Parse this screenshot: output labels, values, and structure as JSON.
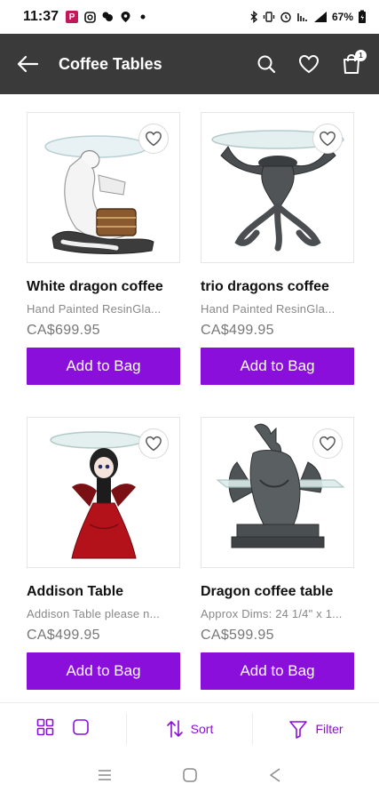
{
  "status_bar": {
    "time": "11:37",
    "p_badge": "P",
    "battery": "67%"
  },
  "app_bar": {
    "title": "Coffee Tables",
    "cart_count": "1",
    "icons": [
      "back-arrow-icon",
      "search-icon",
      "heart-icon",
      "shopping-bag-icon"
    ]
  },
  "products": [
    {
      "name": "White dragon coffee",
      "description": "Hand Painted ResinGla...",
      "price": "CA$699.95",
      "button": "Add to Bag"
    },
    {
      "name": "trio dragons coffee",
      "description": "Hand Painted ResinGla...",
      "price": "CA$499.95",
      "button": "Add to Bag"
    },
    {
      "name": "Addison Table",
      "description": "Addison Table please n...",
      "price": "CA$499.95",
      "button": "Add to Bag"
    },
    {
      "name": "Dragon coffee table",
      "description": "Approx Dims: 24 1/4\" x 1...",
      "price": "CA$599.95",
      "button": "Add to Bag"
    }
  ],
  "bottom_bar": {
    "sort_label": "Sort",
    "filter_label": "Filter"
  },
  "colors": {
    "accent": "#8a0fdb",
    "app_bar": "#3a3a3a"
  }
}
